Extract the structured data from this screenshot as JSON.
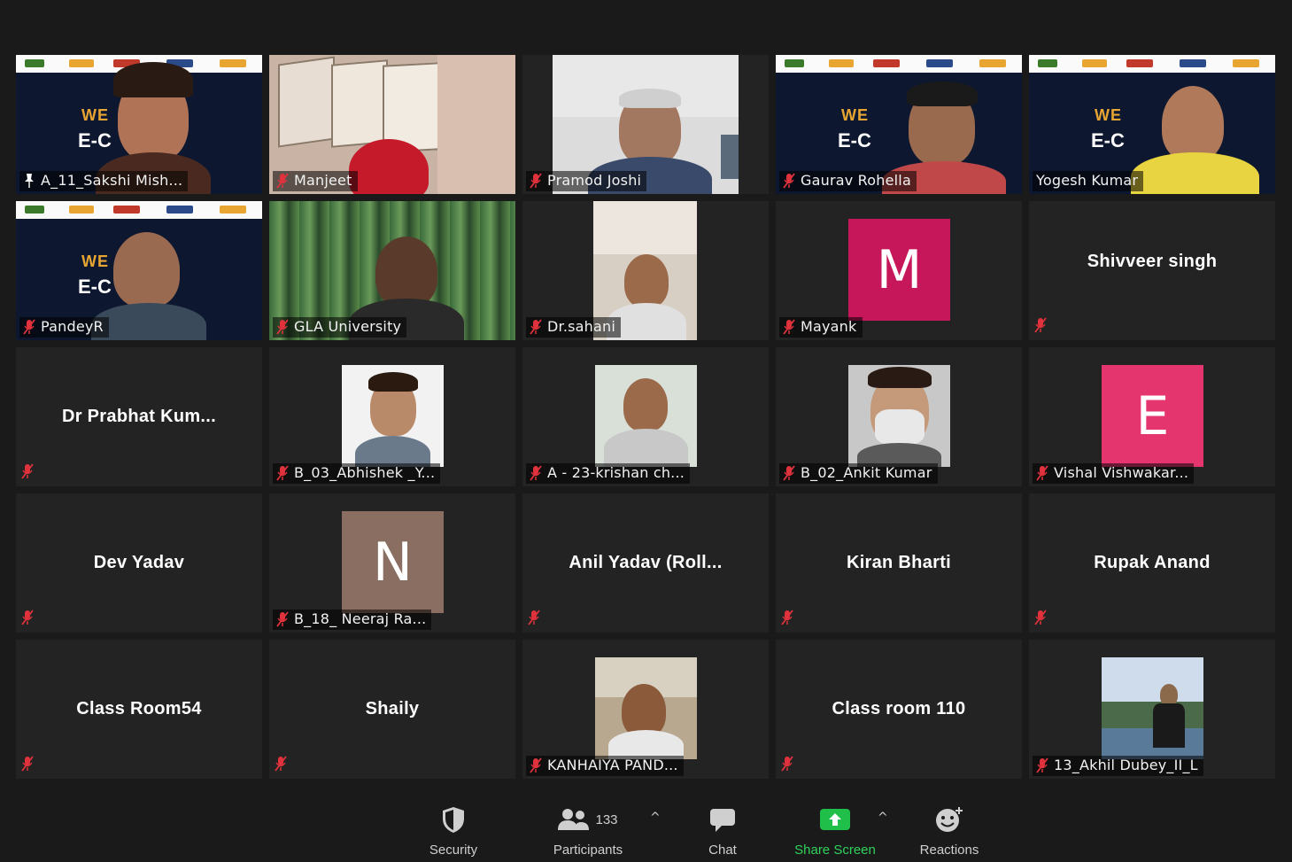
{
  "meeting": {
    "participants": [
      {
        "name": "A_11_Sakshi Mish...",
        "video": "banner",
        "active": true,
        "pinned": true
      },
      {
        "name": "Manjeet",
        "video": "room",
        "muted": true
      },
      {
        "name": "Pramod Joshi",
        "video": "person",
        "muted": true
      },
      {
        "name": "Gaurav Rohella",
        "video": "banner",
        "muted": true
      },
      {
        "name": "Yogesh Kumar",
        "video": "banner"
      },
      {
        "name": "PandeyR",
        "video": "banner",
        "muted": true
      },
      {
        "name": "GLA University",
        "video": "curtain",
        "muted": true
      },
      {
        "name": "Dr.sahani",
        "video": "person-small",
        "muted": true
      },
      {
        "name": "Mayank",
        "video": "avatar",
        "avatar_letter": "M",
        "avatar_color": "#c7175b",
        "muted": true
      },
      {
        "name": "Shivveer singh",
        "video": "none",
        "muted": true
      },
      {
        "name": "Dr Prabhat Kum...",
        "video": "none",
        "muted": true
      },
      {
        "name": "B_03_Abhishek _Y...",
        "video": "person-small",
        "muted": true
      },
      {
        "name": "A - 23-krishan ch...",
        "video": "person-small",
        "muted": true
      },
      {
        "name": "B_02_Ankit Kumar",
        "video": "person-small",
        "muted": true
      },
      {
        "name": "Vishal Vishwakar...",
        "video": "avatar",
        "avatar_letter": "E",
        "avatar_color": "#e5356f",
        "muted": true
      },
      {
        "name": "Dev Yadav",
        "video": "none",
        "muted": true
      },
      {
        "name": "B_18_ Neeraj Ra...",
        "video": "avatar",
        "avatar_letter": "N",
        "avatar_color": "#8a6e62",
        "muted": true
      },
      {
        "name": "Anil Yadav (Roll...",
        "video": "none",
        "muted": true
      },
      {
        "name": "Kiran Bharti",
        "video": "none",
        "muted": true
      },
      {
        "name": "Rupak Anand",
        "video": "none",
        "muted": true
      },
      {
        "name": "Class Room54",
        "video": "none",
        "muted": true
      },
      {
        "name": "Shaily",
        "video": "none",
        "muted": true
      },
      {
        "name": "KANHAIYA PAND...",
        "video": "person-small",
        "muted": true
      },
      {
        "name": "Class room 110",
        "video": "none",
        "muted": true
      },
      {
        "name": "13_Akhil Dubey_II_L",
        "video": "person-small",
        "muted": true
      }
    ],
    "banner": {
      "welcome": "WE",
      "event": "E-C"
    }
  },
  "toolbar": {
    "security_label": "Security",
    "participants_label": "Participants",
    "participants_count": "133",
    "chat_label": "Chat",
    "share_label": "Share Screen",
    "reactions_label": "Reactions"
  },
  "colors": {
    "background": "#1a1a1a",
    "tile": "#232323",
    "active_border": "#e8f06a",
    "muted_icon": "#e0323c",
    "share_green": "#2fd25b"
  }
}
